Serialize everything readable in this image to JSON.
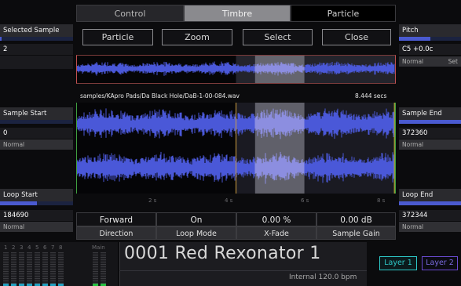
{
  "tabs": [
    {
      "label": "Control"
    },
    {
      "label": "Timbre"
    },
    {
      "label": "Particle"
    }
  ],
  "left_params": {
    "selected_sample": {
      "title": "Selected Sample",
      "value": "2",
      "bar": 0.02
    },
    "sample_start": {
      "title": "Sample Start",
      "value": "0",
      "mode": "Normal",
      "bar": 0.0
    },
    "loop_start": {
      "title": "Loop Start",
      "value": "184690",
      "mode": "Normal",
      "bar": 0.5
    }
  },
  "right_params": {
    "pitch": {
      "title": "Pitch",
      "value": "C5 +0.0c",
      "mode": "Normal",
      "set": "Set",
      "bar": 0.5
    },
    "sample_end": {
      "title": "Sample End",
      "value": "372360",
      "mode": "Normal",
      "bar": 1.0
    },
    "loop_end": {
      "title": "Loop End",
      "value": "372344",
      "mode": "Normal",
      "bar": 1.0
    }
  },
  "buttons": [
    {
      "label": "Particle"
    },
    {
      "label": "Zoom"
    },
    {
      "label": "Select"
    },
    {
      "label": "Close"
    }
  ],
  "sample": {
    "path": "samples/KApro Pads/Da Black Hole/DaB-1-00-084.wav",
    "duration": "8.444 secs"
  },
  "time_ticks": [
    "2 s",
    "4 s",
    "6 s",
    "8 s"
  ],
  "bottom_params": [
    {
      "value": "Forward",
      "label": "Direction"
    },
    {
      "value": "On",
      "label": "Loop Mode"
    },
    {
      "value": "0.00 %",
      "label": "X-Fade"
    },
    {
      "value": "0.00 dB",
      "label": "Sample Gain"
    }
  ],
  "meters": {
    "labels": [
      "1",
      "2",
      "3",
      "4",
      "5",
      "6",
      "7",
      "8",
      "Main"
    ]
  },
  "program": {
    "name": "0001 Red Rexonator 1",
    "tempo": "Internal 120.0 bpm"
  },
  "layers": [
    {
      "label": "Layer 1"
    },
    {
      "label": "Layer 2"
    }
  ],
  "colors": {
    "waveform": "#4a58d8",
    "loop_region": "#9a9aa6",
    "accent_cyan": "#2ec8c8",
    "accent_purple": "#6a4ad0"
  }
}
